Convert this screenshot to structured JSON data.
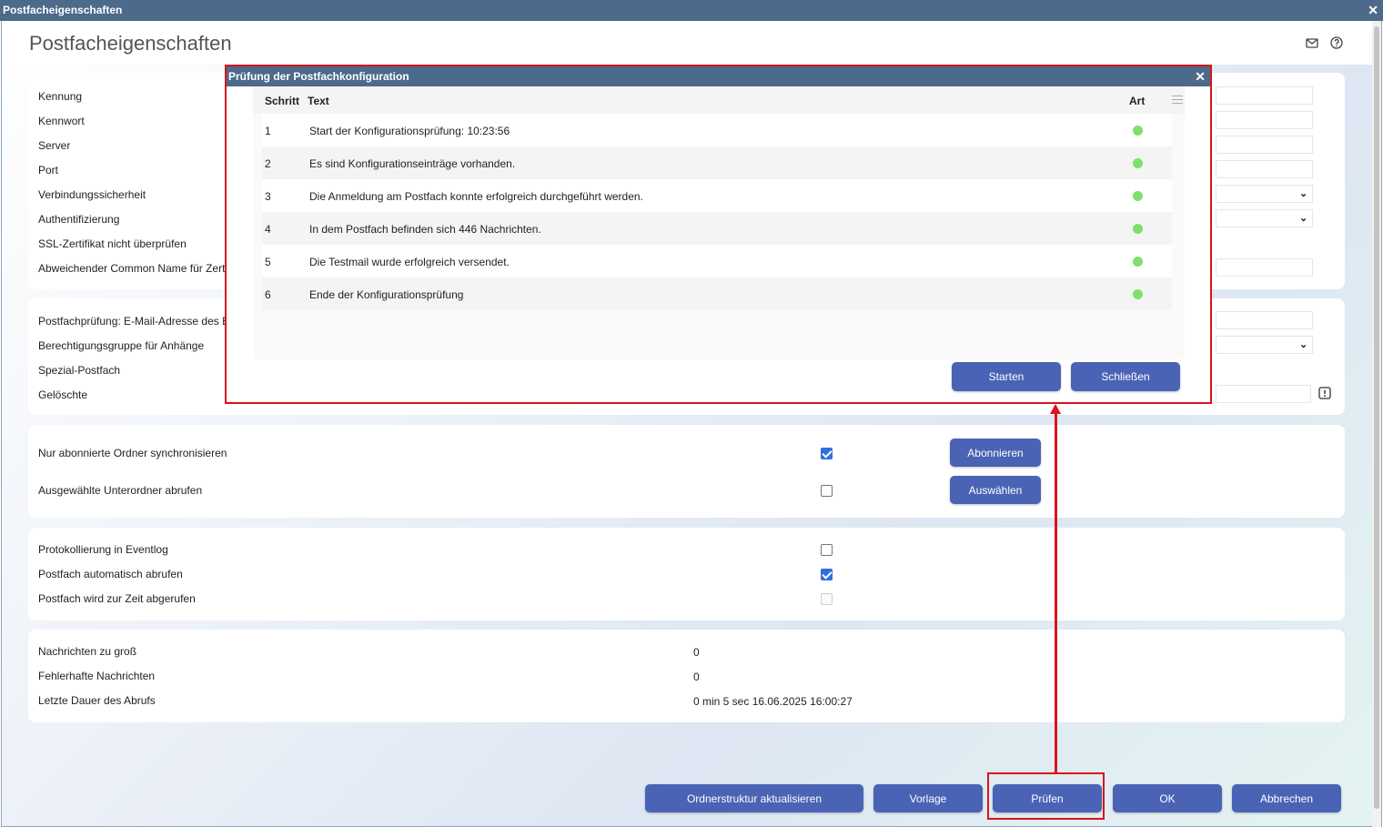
{
  "window": {
    "title": "Postfacheigenschaften",
    "heading": "Postfacheigenschaften"
  },
  "icons": {
    "mail": "envelope-icon",
    "help": "help-circle-icon",
    "info": "exclamation-box-icon",
    "close": "close-icon"
  },
  "connection": {
    "rows": [
      "Kennung",
      "Kennwort",
      "Server",
      "Port",
      "Verbindungssicherheit",
      "Authentifizierung",
      "SSL-Zertifikat nicht überprüfen",
      "Abweichender Common Name für Zert"
    ]
  },
  "check": {
    "rows": [
      "Postfachprüfung: E-Mail-Adresse des E",
      "Berechtigungsgruppe für Anhänge",
      "Spezial-Postfach",
      "Gelöschte"
    ]
  },
  "folders": {
    "sync_label": "Nur abonnierte Ordner synchronisieren",
    "sync_checked": true,
    "subscribe_button": "Abonnieren",
    "sub_label": "Ausgewählte Unterordner abrufen",
    "sub_checked": false,
    "select_button": "Auswählen"
  },
  "logging": {
    "eventlog_label": "Protokollierung in Eventlog",
    "eventlog_checked": false,
    "auto_label": "Postfach automatisch abrufen",
    "auto_checked": true,
    "busy_label": "Postfach wird zur Zeit abgerufen",
    "busy_checked": false
  },
  "stats": {
    "too_large_label": "Nachrichten zu groß",
    "too_large_value": "0",
    "faulty_label": "Fehlerhafte Nachrichten",
    "faulty_value": "0",
    "duration_label": "Letzte Dauer des Abrufs",
    "duration_value": "0 min 5 sec 16.06.2025 16:00:27"
  },
  "footer": {
    "refresh_button": "Ordnerstruktur aktualisieren",
    "template_button": "Vorlage",
    "check_button": "Prüfen",
    "ok_button": "OK",
    "cancel_button": "Abbrechen"
  },
  "dialog": {
    "title": "Prüfung der Postfachkonfiguration",
    "columns": {
      "step": "Schritt",
      "text": "Text",
      "type": "Art"
    },
    "rows": [
      {
        "step": "1",
        "text": "Start der Konfigurationsprüfung: 10:23:56",
        "status_color": "#7ee06a"
      },
      {
        "step": "2",
        "text": "Es sind Konfigurationseinträge vorhanden.",
        "status_color": "#7ee06a"
      },
      {
        "step": "3",
        "text": "Die Anmeldung am Postfach konnte erfolgreich durchgeführt werden.",
        "status_color": "#7ee06a"
      },
      {
        "step": "4",
        "text": "In dem Postfach befinden sich 446 Nachrichten.",
        "status_color": "#7ee06a"
      },
      {
        "step": "5",
        "text": "Die Testmail wurde erfolgreich versendet.",
        "status_color": "#7ee06a"
      },
      {
        "step": "6",
        "text": "Ende der Konfigurationsprüfung",
        "status_color": "#7ee06a"
      }
    ],
    "start_button": "Starten",
    "close_button": "Schließen"
  },
  "colors": {
    "accent": "#4a63b5",
    "titlebar": "#4c6a8a",
    "highlight": "#d9141b",
    "status_ok": "#7ee06a"
  }
}
